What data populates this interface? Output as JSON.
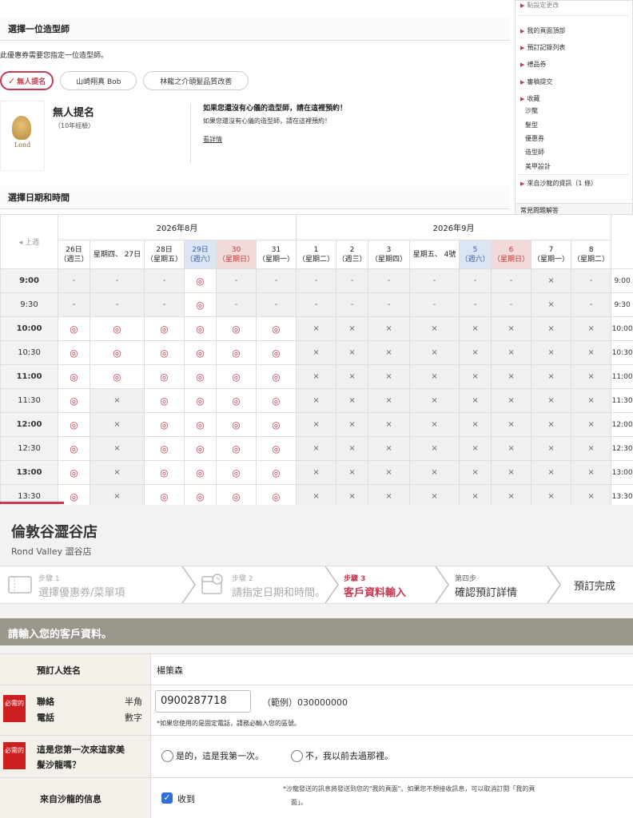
{
  "sidebar": {
    "top_cut": "點設定更改",
    "items": [
      "我的頁面頂部",
      "預訂記錄列表",
      "禮品券",
      "審稿提交",
      "收藏"
    ],
    "sub_items": [
      "沙龍",
      "髮型",
      "優惠券",
      "造型師",
      "美甲設計"
    ],
    "salon_info": "來自沙龍的資訊（1 條）",
    "faq": "常見問題解答"
  },
  "stylist_section": {
    "title": "選擇一位造型師",
    "note": "此優惠券需要您指定一位造型師。",
    "chips": [
      "無人提名",
      "山崎翔真 Bob",
      "林龍之介頭髮品質改善"
    ],
    "selected_name": "無人提名",
    "experience": "（10年經驗）",
    "logo_text": "Lond",
    "msg_heading": "如果您還沒有心儀的造型師，請在這裡預約！",
    "msg_body": "如果您還沒有心儀的造型師，請在這裡預約！",
    "details_link": "看詳情"
  },
  "datetime_section": {
    "title": "選擇日期和時間"
  },
  "calendar": {
    "prev_week": "◂ 上週",
    "month1": "2026年8月",
    "month2": "2026年9月",
    "days": [
      {
        "d": "26日",
        "w": "（週三）",
        "k": ""
      },
      {
        "d": "",
        "w": "星期四、 27日",
        "k": ""
      },
      {
        "d": "28日",
        "w": "（星期五）",
        "k": ""
      },
      {
        "d": "29日",
        "w": "（週六）",
        "k": "sat"
      },
      {
        "d": "30",
        "w": "（星期日）",
        "k": "sun"
      },
      {
        "d": "31",
        "w": "（星期一）",
        "k": ""
      },
      {
        "d": "1",
        "w": "（星期二）",
        "k": ""
      },
      {
        "d": "2",
        "w": "（週三）",
        "k": ""
      },
      {
        "d": "3",
        "w": "（星期四）",
        "k": ""
      },
      {
        "d": "",
        "w": "星期五、 4號",
        "k": ""
      },
      {
        "d": "5",
        "w": "（週六）",
        "k": "sat"
      },
      {
        "d": "6",
        "w": "（星期日）",
        "k": "sun"
      },
      {
        "d": "7",
        "w": "（星期一）",
        "k": ""
      },
      {
        "d": "8",
        "w": "（星期二）",
        "k": ""
      }
    ],
    "rows": [
      {
        "t": "9:00",
        "s": "---o--------x----"
      },
      {
        "t": "9:30",
        "s": "---o--------x----"
      },
      {
        "t": "10:00",
        "s": "oooooo xxxxxxxx"
      },
      {
        "t": "10:30",
        "s": "oooooo xxxxxxxx"
      },
      {
        "t": "11:00",
        "s": "oooooo xxxxxxxx"
      },
      {
        "t": "11:30",
        "s": "oxoooo xxxxxxxx"
      },
      {
        "t": "12:00",
        "s": "oxoooo xxxxxxxx"
      },
      {
        "t": "12:30",
        "s": "oxoooo xxxxxxxx"
      },
      {
        "t": "13:00",
        "s": "oxoooo xxxxxxxx"
      },
      {
        "t": "13:30",
        "s": "oxoooo xxxxxxxx"
      }
    ],
    "symbols": {
      "open": "◎",
      "closed": "×",
      "none": "-"
    }
  },
  "shop": {
    "name": "倫敦谷澀谷店",
    "sub": "Rond Valley 澀谷店"
  },
  "steps": [
    {
      "n": "步驟 1",
      "l": "選擇優惠券/菜單項"
    },
    {
      "n": "步驟 2",
      "l": "請指定日期和時間。"
    },
    {
      "n": "步驟 3",
      "l": "客戶資料輸入"
    },
    {
      "n": "第四步",
      "l": "確認預訂詳情"
    },
    {
      "n": "",
      "l": "預訂完成"
    }
  ],
  "form": {
    "heading": "請輸入您的客戶資料。",
    "name_label": "預訂人姓名",
    "name_value": "楊策森",
    "required": "必需的",
    "phone_label1": "聯絡",
    "phone_label2": "電話",
    "phone_half1": "半角",
    "phone_half2": "數字",
    "phone_value": "0900287718",
    "phone_example": "（範例）030000000",
    "phone_note": "*如果您使用的是固定電話，請務必輸入您的區號。",
    "first_label1": "這是您第一次來這家美",
    "first_label2": "髮沙龍嗎？",
    "first_opt1": "是的，這是我第一次。",
    "first_opt2": "不，我以前去過那裡。",
    "msg_label": "來自沙龍的信息",
    "msg_check": "收到",
    "msg_note1": "*沙龍發送的訊息將發送到您的\"我的頁面\"。如果您不想接收訊息，可以取消訂閱「我的頁",
    "msg_note2": "面」。"
  }
}
